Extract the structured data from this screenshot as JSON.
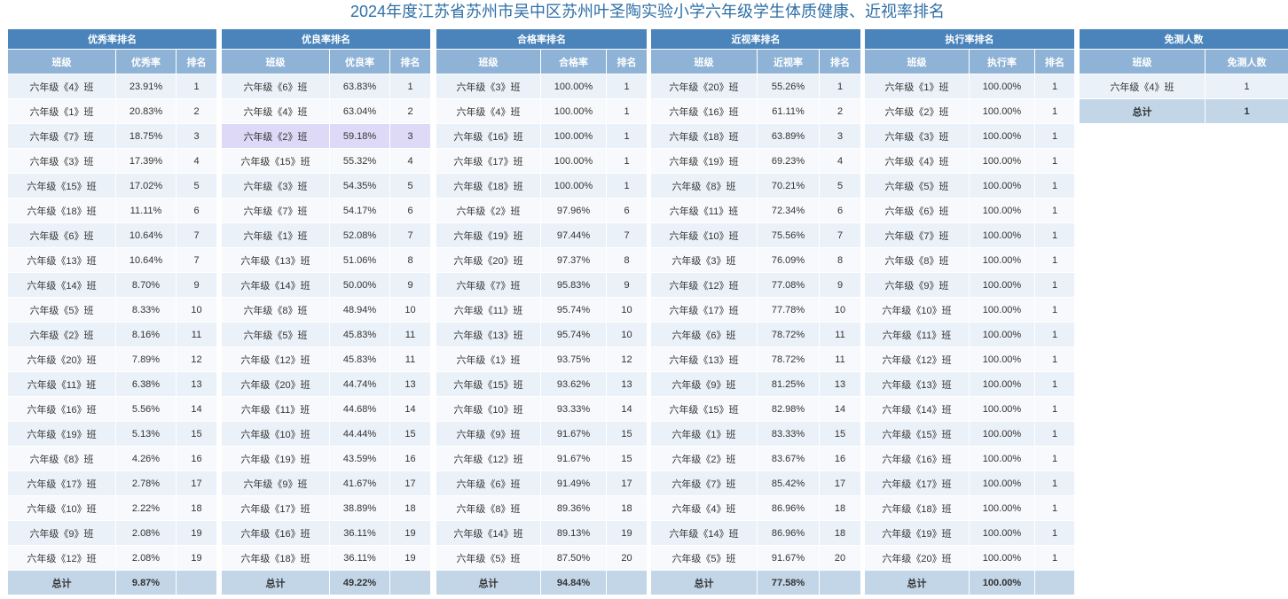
{
  "page_title": "2024年度江苏省苏州市吴中区苏州叶圣陶实验小学六年级学生体质健康、近视率排名",
  "tables": [
    {
      "title": "优秀率排名",
      "headers": [
        "班级",
        "优秀率",
        "排名"
      ],
      "rows": [
        [
          "六年级《4》班",
          "23.91%",
          "1"
        ],
        [
          "六年级《1》班",
          "20.83%",
          "2"
        ],
        [
          "六年级《7》班",
          "18.75%",
          "3"
        ],
        [
          "六年级《3》班",
          "17.39%",
          "4"
        ],
        [
          "六年级《15》班",
          "17.02%",
          "5"
        ],
        [
          "六年级《18》班",
          "11.11%",
          "6"
        ],
        [
          "六年级《6》班",
          "10.64%",
          "7"
        ],
        [
          "六年级《13》班",
          "10.64%",
          "7"
        ],
        [
          "六年级《14》班",
          "8.70%",
          "9"
        ],
        [
          "六年级《5》班",
          "8.33%",
          "10"
        ],
        [
          "六年级《2》班",
          "8.16%",
          "11"
        ],
        [
          "六年级《20》班",
          "7.89%",
          "12"
        ],
        [
          "六年级《11》班",
          "6.38%",
          "13"
        ],
        [
          "六年级《16》班",
          "5.56%",
          "14"
        ],
        [
          "六年级《19》班",
          "5.13%",
          "15"
        ],
        [
          "六年级《8》班",
          "4.26%",
          "16"
        ],
        [
          "六年级《17》班",
          "2.78%",
          "17"
        ],
        [
          "六年级《10》班",
          "2.22%",
          "18"
        ],
        [
          "六年级《9》班",
          "2.08%",
          "19"
        ],
        [
          "六年级《12》班",
          "2.08%",
          "19"
        ]
      ],
      "total": [
        "总计",
        "9.87%",
        ""
      ]
    },
    {
      "title": "优良率排名",
      "headers": [
        "班级",
        "优良率",
        "排名"
      ],
      "rows": [
        [
          "六年级《6》班",
          "63.83%",
          "1"
        ],
        [
          "六年级《4》班",
          "63.04%",
          "2"
        ],
        [
          "六年级《2》班",
          "59.18%",
          "3"
        ],
        [
          "六年级《15》班",
          "55.32%",
          "4"
        ],
        [
          "六年级《3》班",
          "54.35%",
          "5"
        ],
        [
          "六年级《7》班",
          "54.17%",
          "6"
        ],
        [
          "六年级《1》班",
          "52.08%",
          "7"
        ],
        [
          "六年级《13》班",
          "51.06%",
          "8"
        ],
        [
          "六年级《14》班",
          "50.00%",
          "9"
        ],
        [
          "六年级《8》班",
          "48.94%",
          "10"
        ],
        [
          "六年级《5》班",
          "45.83%",
          "11"
        ],
        [
          "六年级《12》班",
          "45.83%",
          "11"
        ],
        [
          "六年级《20》班",
          "44.74%",
          "13"
        ],
        [
          "六年级《11》班",
          "44.68%",
          "14"
        ],
        [
          "六年级《10》班",
          "44.44%",
          "15"
        ],
        [
          "六年级《19》班",
          "43.59%",
          "16"
        ],
        [
          "六年级《9》班",
          "41.67%",
          "17"
        ],
        [
          "六年级《17》班",
          "38.89%",
          "18"
        ],
        [
          "六年级《16》班",
          "36.11%",
          "19"
        ],
        [
          "六年级《18》班",
          "36.11%",
          "19"
        ]
      ],
      "total": [
        "总计",
        "49.22%",
        ""
      ],
      "highlight_row": 2
    },
    {
      "title": "合格率排名",
      "headers": [
        "班级",
        "合格率",
        "排名"
      ],
      "rows": [
        [
          "六年级《3》班",
          "100.00%",
          "1"
        ],
        [
          "六年级《4》班",
          "100.00%",
          "1"
        ],
        [
          "六年级《16》班",
          "100.00%",
          "1"
        ],
        [
          "六年级《17》班",
          "100.00%",
          "1"
        ],
        [
          "六年级《18》班",
          "100.00%",
          "1"
        ],
        [
          "六年级《2》班",
          "97.96%",
          "6"
        ],
        [
          "六年级《19》班",
          "97.44%",
          "7"
        ],
        [
          "六年级《20》班",
          "97.37%",
          "8"
        ],
        [
          "六年级《7》班",
          "95.83%",
          "9"
        ],
        [
          "六年级《11》班",
          "95.74%",
          "10"
        ],
        [
          "六年级《13》班",
          "95.74%",
          "10"
        ],
        [
          "六年级《1》班",
          "93.75%",
          "12"
        ],
        [
          "六年级《15》班",
          "93.62%",
          "13"
        ],
        [
          "六年级《10》班",
          "93.33%",
          "14"
        ],
        [
          "六年级《9》班",
          "91.67%",
          "15"
        ],
        [
          "六年级《12》班",
          "91.67%",
          "15"
        ],
        [
          "六年级《6》班",
          "91.49%",
          "17"
        ],
        [
          "六年级《8》班",
          "89.36%",
          "18"
        ],
        [
          "六年级《14》班",
          "89.13%",
          "19"
        ],
        [
          "六年级《5》班",
          "87.50%",
          "20"
        ]
      ],
      "total": [
        "总计",
        "94.84%",
        ""
      ]
    },
    {
      "title": "近视率排名",
      "headers": [
        "班级",
        "近视率",
        "排名"
      ],
      "rows": [
        [
          "六年级《20》班",
          "55.26%",
          "1"
        ],
        [
          "六年级《16》班",
          "61.11%",
          "2"
        ],
        [
          "六年级《18》班",
          "63.89%",
          "3"
        ],
        [
          "六年级《19》班",
          "69.23%",
          "4"
        ],
        [
          "六年级《8》班",
          "70.21%",
          "5"
        ],
        [
          "六年级《11》班",
          "72.34%",
          "6"
        ],
        [
          "六年级《10》班",
          "75.56%",
          "7"
        ],
        [
          "六年级《3》班",
          "76.09%",
          "8"
        ],
        [
          "六年级《12》班",
          "77.08%",
          "9"
        ],
        [
          "六年级《17》班",
          "77.78%",
          "10"
        ],
        [
          "六年级《6》班",
          "78.72%",
          "11"
        ],
        [
          "六年级《13》班",
          "78.72%",
          "11"
        ],
        [
          "六年级《9》班",
          "81.25%",
          "13"
        ],
        [
          "六年级《15》班",
          "82.98%",
          "14"
        ],
        [
          "六年级《1》班",
          "83.33%",
          "15"
        ],
        [
          "六年级《2》班",
          "83.67%",
          "16"
        ],
        [
          "六年级《7》班",
          "85.42%",
          "17"
        ],
        [
          "六年级《4》班",
          "86.96%",
          "18"
        ],
        [
          "六年级《14》班",
          "86.96%",
          "18"
        ],
        [
          "六年级《5》班",
          "91.67%",
          "20"
        ]
      ],
      "total": [
        "总计",
        "77.58%",
        ""
      ]
    },
    {
      "title": "执行率排名",
      "headers": [
        "班级",
        "执行率",
        "排名"
      ],
      "rows": [
        [
          "六年级《1》班",
          "100.00%",
          "1"
        ],
        [
          "六年级《2》班",
          "100.00%",
          "1"
        ],
        [
          "六年级《3》班",
          "100.00%",
          "1"
        ],
        [
          "六年级《4》班",
          "100.00%",
          "1"
        ],
        [
          "六年级《5》班",
          "100.00%",
          "1"
        ],
        [
          "六年级《6》班",
          "100.00%",
          "1"
        ],
        [
          "六年级《7》班",
          "100.00%",
          "1"
        ],
        [
          "六年级《8》班",
          "100.00%",
          "1"
        ],
        [
          "六年级《9》班",
          "100.00%",
          "1"
        ],
        [
          "六年级《10》班",
          "100.00%",
          "1"
        ],
        [
          "六年级《11》班",
          "100.00%",
          "1"
        ],
        [
          "六年级《12》班",
          "100.00%",
          "1"
        ],
        [
          "六年级《13》班",
          "100.00%",
          "1"
        ],
        [
          "六年级《14》班",
          "100.00%",
          "1"
        ],
        [
          "六年级《15》班",
          "100.00%",
          "1"
        ],
        [
          "六年级《16》班",
          "100.00%",
          "1"
        ],
        [
          "六年级《17》班",
          "100.00%",
          "1"
        ],
        [
          "六年级《18》班",
          "100.00%",
          "1"
        ],
        [
          "六年级《19》班",
          "100.00%",
          "1"
        ],
        [
          "六年级《20》班",
          "100.00%",
          "1"
        ]
      ],
      "total": [
        "总计",
        "100.00%",
        ""
      ]
    },
    {
      "title": "免测人数",
      "headers": [
        "班级",
        "免测人数"
      ],
      "rows": [
        [
          "六年级《4》班",
          "1"
        ]
      ],
      "total": [
        "总计",
        "1"
      ]
    }
  ]
}
